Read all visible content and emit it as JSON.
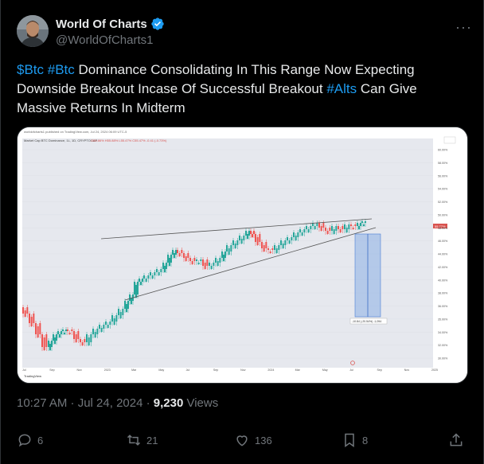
{
  "author": {
    "name": "World Of Charts",
    "handle": "@WorldOfCharts1",
    "verified_color": "#1d9bf0"
  },
  "more_label": "···",
  "tweet": {
    "parts": [
      {
        "text": "$Btc",
        "tag": true
      },
      {
        "text": " ",
        "tag": false
      },
      {
        "text": "#Btc",
        "tag": true
      },
      {
        "text": " Dominance Consolidating In This Range Now Expecting Downside Breakout Incase Of Successful Breakout ",
        "tag": false
      },
      {
        "text": "#Alts",
        "tag": true
      },
      {
        "text": " Can Give Massive Returns In Midterm",
        "tag": false
      }
    ]
  },
  "chart": {
    "header_line": "worldofcharts1 published on TradingView.com, Jul 24, 2024 06:09 UTC-5",
    "title_line": "Market Cap BTC Dominance, 1L, 1D, CRYPTOCAP",
    "ohlc_line": "O55.86% H55.88% L55.47% C55.47% -0.41 (-0.73%)",
    "price_tag": "55.77%",
    "measure_label": "-10.84 (-20.54%) -1,094",
    "x_ticks": [
      "Jul",
      "Sep",
      "Nov",
      "2023",
      "Mar",
      "May",
      "Jul",
      "Sep",
      "Nov",
      "2024",
      "Mar",
      "May",
      "Jul",
      "Sep",
      "Nov",
      "2025"
    ],
    "y_ticks": [
      "60.00%",
      "58.00%",
      "56.00%",
      "54.00%",
      "52.00%",
      "50.00%",
      "48.00%",
      "46.00%",
      "44.00%",
      "42.00%",
      "40.00%",
      "38.00%",
      "36.00%",
      "35.00%",
      "34.00%",
      "32.00%",
      "30.00%"
    ],
    "footer": "TradingView"
  },
  "meta": {
    "time": "10:27 AM · Jul 24, 2024 · ",
    "views_count": "9,230",
    "views_label": " Views"
  },
  "actions": {
    "replies": "6",
    "reposts": "21",
    "likes": "136",
    "bookmarks": "8"
  }
}
